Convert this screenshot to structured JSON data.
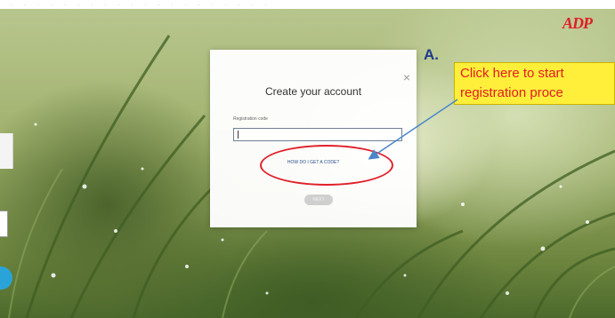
{
  "modal": {
    "title": "Create your account",
    "field_label": "Registration code",
    "field_value": "",
    "link_text": "HOW DO I GET A CODE?",
    "next_label": "NEXT",
    "close_glyph": "×"
  },
  "brand": {
    "logo_text": "ADP",
    "logo_color": "#e01f26"
  },
  "annotation": {
    "letter": "A.",
    "callout_line1": "Click here to start",
    "callout_line2": "registration proce",
    "callout_bg": "#ffef3a",
    "callout_text_color": "#e21b23",
    "ellipse_color": "#e0202a",
    "arrow_color": "#4a86c8"
  },
  "icons": {
    "close": "close-icon",
    "logo": "adp-logo"
  }
}
